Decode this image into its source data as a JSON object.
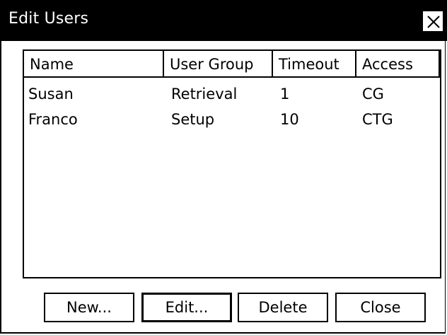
{
  "window": {
    "title": "Edit Users",
    "close_glyph": "close-icon"
  },
  "table": {
    "columns": [
      "Name",
      "User Group",
      "Timeout",
      "Access"
    ],
    "rows": [
      {
        "name": "Susan",
        "group": "Retrieval",
        "timeout": "1",
        "access": "CG"
      },
      {
        "name": "Franco",
        "group": "Setup",
        "timeout": "10",
        "access": "CTG"
      }
    ]
  },
  "buttons": {
    "new_label": "New...",
    "edit_label": "Edit...",
    "delete_label": "Delete",
    "close_label": "Close"
  }
}
